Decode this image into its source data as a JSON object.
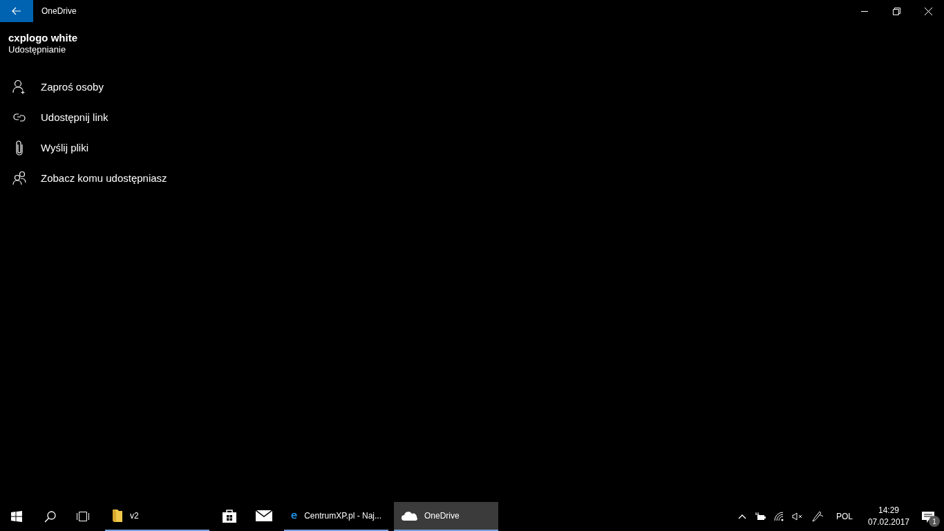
{
  "window": {
    "title": "OneDrive"
  },
  "header": {
    "title": "cxplogo white",
    "subtitle": "Udostępnianie"
  },
  "actions": [
    {
      "kind": "invite",
      "label": "Zaproś osoby"
    },
    {
      "kind": "link",
      "label": "Udostępnij link"
    },
    {
      "kind": "attach",
      "label": "Wyślij pliki"
    },
    {
      "kind": "people",
      "label": "Zobacz komu udostępniasz"
    }
  ],
  "taskbar": {
    "apps": [
      {
        "kind": "folder",
        "label": "v2",
        "running": true,
        "selected": false
      },
      {
        "kind": "store",
        "running": false,
        "selected": false
      },
      {
        "kind": "mail",
        "running": false,
        "selected": false
      },
      {
        "kind": "edge",
        "label": "CentrumXP.pl - Naj...",
        "running": true,
        "selected": false
      },
      {
        "kind": "cloud",
        "label": "OneDrive",
        "running": true,
        "selected": true
      }
    ],
    "language": "POL",
    "time": "14:29",
    "date": "07.02.2017",
    "notifications": "1"
  }
}
